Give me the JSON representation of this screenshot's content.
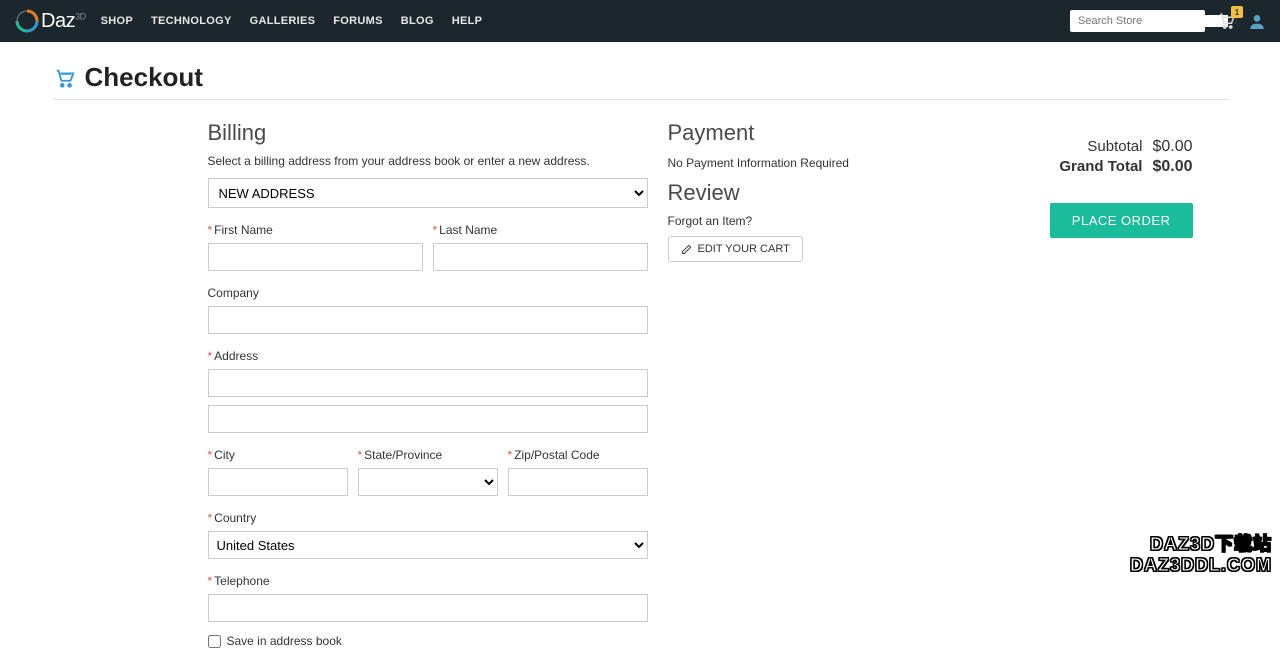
{
  "header": {
    "logo_text": "Daz",
    "logo_sup": "3D",
    "nav": [
      "SHOP",
      "TECHNOLOGY",
      "GALLERIES",
      "FORUMS",
      "BLOG",
      "HELP"
    ],
    "search_placeholder": "Search Store",
    "cart_badge": "1"
  },
  "page_title": "Checkout",
  "billing": {
    "heading": "Billing",
    "subtext": "Select a billing address from your address book or enter a new address.",
    "address_select": "NEW ADDRESS",
    "labels": {
      "first_name": "First Name",
      "last_name": "Last Name",
      "company": "Company",
      "address": "Address",
      "city": "City",
      "state": "State/Province",
      "zip": "Zip/Postal Code",
      "country": "Country",
      "telephone": "Telephone",
      "save": "Save in address book"
    },
    "country_value": "United States"
  },
  "payment": {
    "heading": "Payment",
    "info": "No Payment Information Required"
  },
  "review": {
    "heading": "Review",
    "forgot": "Forgot an Item?",
    "edit_cart": "EDIT YOUR CART",
    "subtotal_label": "Subtotal",
    "subtotal_value": "$0.00",
    "grand_label": "Grand Total",
    "grand_value": "$0.00",
    "place_order": "PLACE ORDER"
  },
  "watermark": {
    "line1": "DAZ3D下载站",
    "line2": "DAZ3DDL.COM"
  }
}
